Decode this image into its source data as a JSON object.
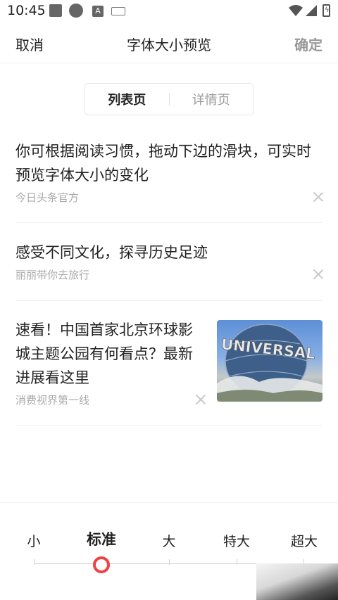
{
  "status_bar": {
    "time": "10:45",
    "notif_letter": "A",
    "icons": [
      "square-icon",
      "circle-icon",
      "a-icon",
      "keyboard-icon",
      "wifi-icon",
      "signal-icon",
      "battery-icon"
    ]
  },
  "header": {
    "cancel_label": "取消",
    "title": "字体大小预览",
    "confirm_label": "确定"
  },
  "tabs": [
    {
      "label": "列表页",
      "active": true
    },
    {
      "label": "详情页",
      "active": false
    }
  ],
  "feed": [
    {
      "title_line1": "你可根据阅读习惯，拖动下边的滑块，可实时",
      "title_line2": "预览字体大小的变化",
      "source": "今日头条官方"
    },
    {
      "title_line1": "感受不同文化，探寻历史足迹",
      "source": "丽丽带你去旅行"
    },
    {
      "title_line1": "速看！中国首家北京环球影",
      "title_line2": "城主题公园有何看点？最新",
      "title_line3": "进展看这里",
      "source": "消费视界第一线",
      "thumbnail_text": "UNIVERSAL"
    }
  ],
  "font_size_selector": {
    "options": [
      "小",
      "标准",
      "大",
      "特大",
      "超大"
    ],
    "selected": "标准",
    "accent_color": "#f04142"
  }
}
